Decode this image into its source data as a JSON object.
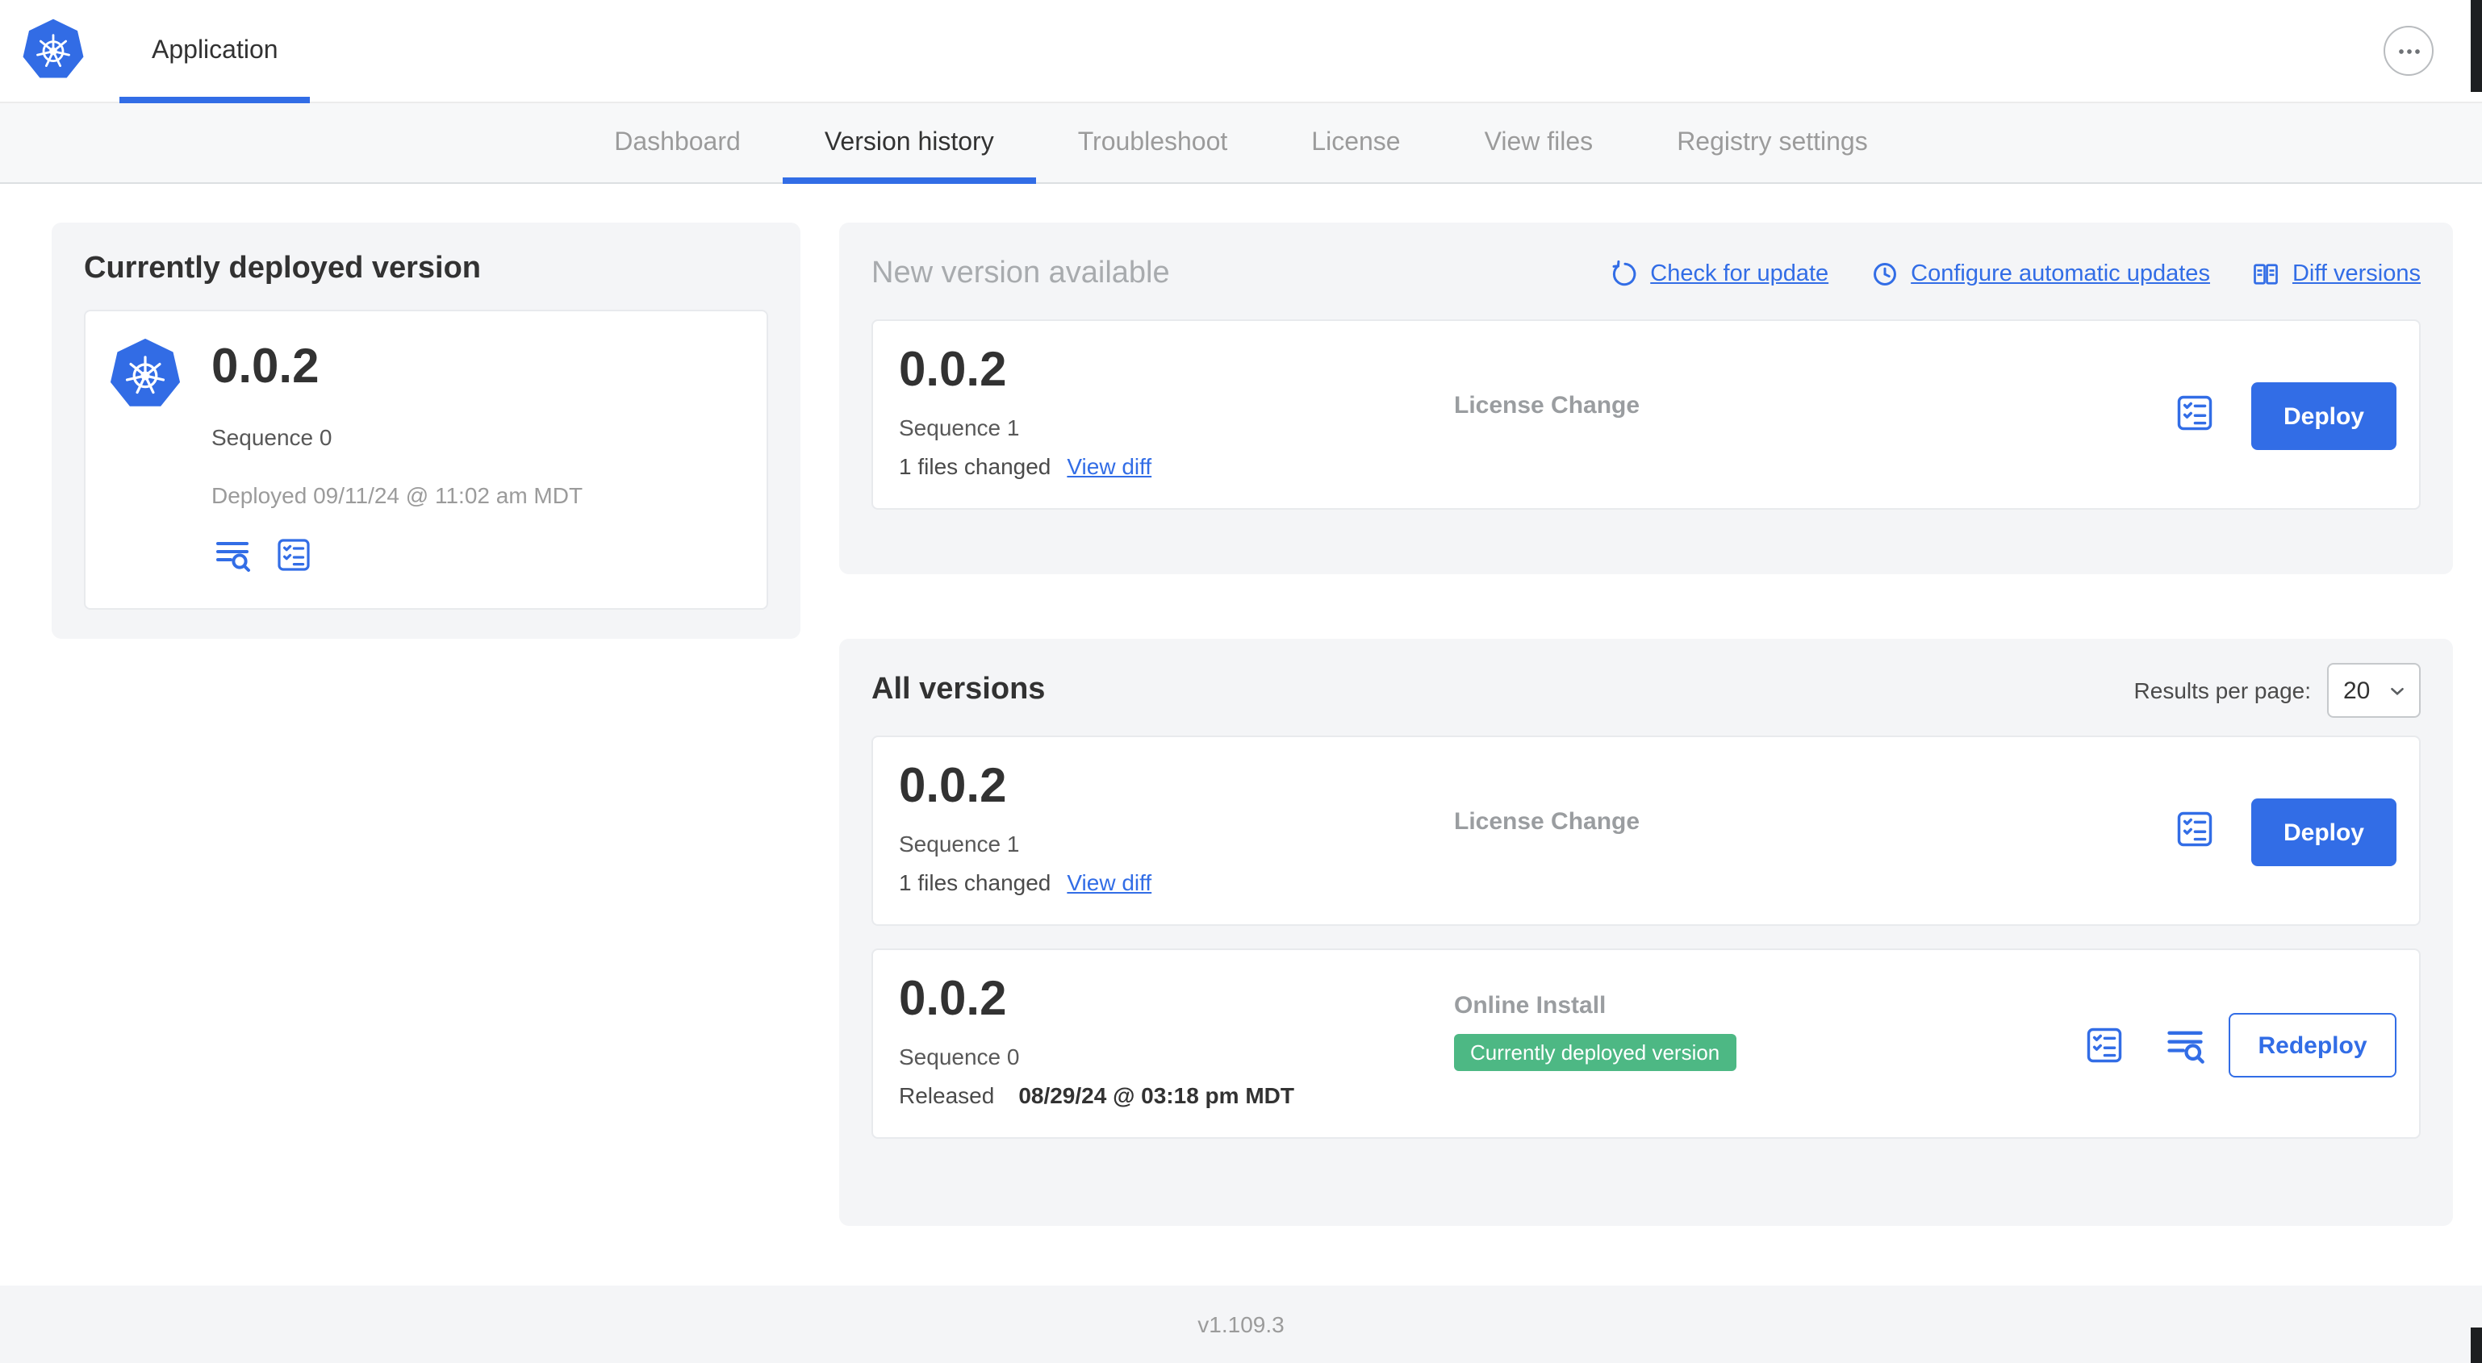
{
  "colors": {
    "primary_blue": "#326de6",
    "badge_green": "#4db884",
    "panel_gray": "#f4f5f7",
    "text_dark": "#323232",
    "text_gray": "#9b9b9b"
  },
  "header": {
    "app_tab": "Application"
  },
  "nav": {
    "items": [
      {
        "label": "Dashboard"
      },
      {
        "label": "Version history"
      },
      {
        "label": "Troubleshoot"
      },
      {
        "label": "License"
      },
      {
        "label": "View files"
      },
      {
        "label": "Registry settings"
      }
    ]
  },
  "current_version": {
    "title": "Currently deployed version",
    "version": "0.0.2",
    "sequence": "Sequence 0",
    "deployed": "Deployed 09/11/24 @ 11:02 am MDT"
  },
  "new_version": {
    "title": "New version available",
    "check_for_update": "Check for update",
    "configure_updates": "Configure automatic updates",
    "diff_versions": "Diff versions",
    "version": "0.0.2",
    "sequence": "Sequence 1",
    "files_changed": "1 files changed",
    "view_diff": "View diff",
    "change_type": "License Change",
    "deploy_label": "Deploy"
  },
  "all_versions": {
    "title": "All versions",
    "results_label": "Results per page:",
    "results_value": "20",
    "rows": [
      {
        "version": "0.0.2",
        "sequence": "Sequence 1",
        "files_changed": "1 files changed",
        "view_diff": "View diff",
        "change_type": "License Change",
        "action_label": "Deploy"
      },
      {
        "version": "0.0.2",
        "sequence": "Sequence 0",
        "released_label": "Released",
        "released_date": "08/29/24 @ 03:18 pm MDT",
        "change_type": "Online Install",
        "badge": "Currently deployed version",
        "action_label": "Redeploy"
      }
    ]
  },
  "footer": {
    "app_version": "v1.109.3"
  }
}
